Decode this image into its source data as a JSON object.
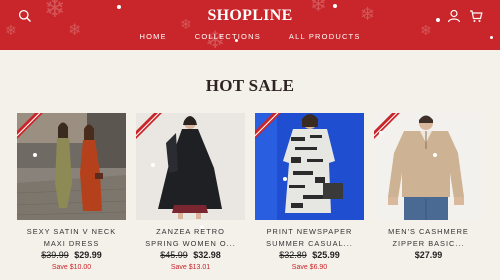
{
  "store": {
    "name": "SHOPLINE"
  },
  "nav": [
    "HOME",
    "COLLECTIONS",
    "ALL PRODUCTS"
  ],
  "icons": {
    "search": "search-icon",
    "account": "user-icon",
    "cart": "cart-icon"
  },
  "colors": {
    "header": "#c8262a",
    "background": "#f4f0ea",
    "sale": "#c8262a"
  },
  "section": {
    "title": "HOT SALE"
  },
  "products": [
    {
      "name": "SEXY SATIN V NECK MAXI DRESS",
      "name_line1": "SEXY SATIN V NECK",
      "name_line2": "MAXI DRESS",
      "old_price": "$39.99",
      "price": "$29.99",
      "save": "Save $10.00"
    },
    {
      "name": "ZANZEA RETRO SPRING WOMEN O...",
      "name_line1": "ZANZEA RETRO",
      "name_line2": "SPRING WOMEN O...",
      "old_price": "$45.99",
      "price": "$32.98",
      "save": "Save $13.01"
    },
    {
      "name": "PRINT NEWSPAPER SUMMER CASUAL...",
      "name_line1": "PRINT NEWSPAPER",
      "name_line2": "SUMMER CASUAL...",
      "old_price": "$32.89",
      "price": "$25.99",
      "save": "Save $6.90"
    },
    {
      "name": "MEN'S CASHMERE ZIPPER BASIC...",
      "name_line1": "MEN'S CASHMERE",
      "name_line2": "ZIPPER BASIC...",
      "old_price": "",
      "price": "$27.99",
      "save": ""
    }
  ]
}
